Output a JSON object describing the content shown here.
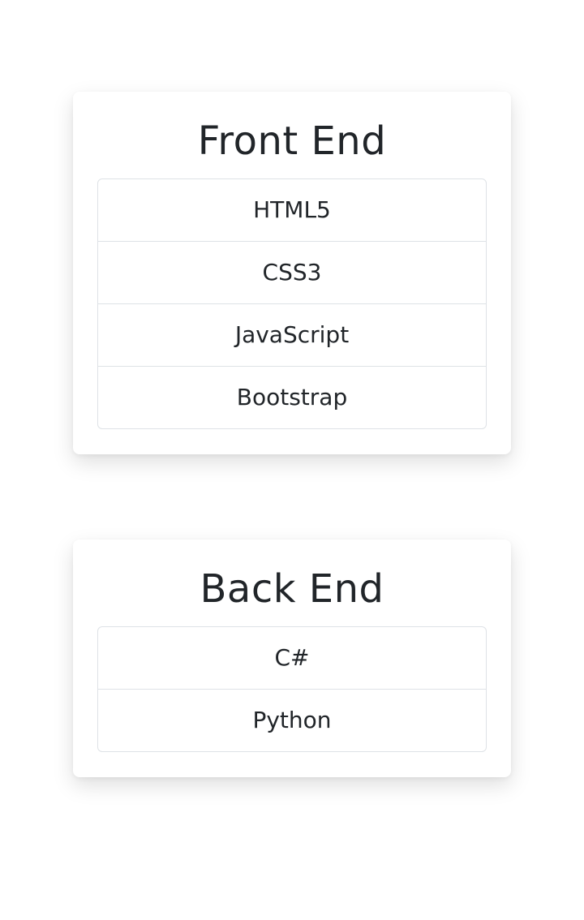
{
  "cards": [
    {
      "title": "Front End",
      "items": [
        "HTML5",
        "CSS3",
        "JavaScript",
        "Bootstrap"
      ]
    },
    {
      "title": "Back End",
      "items": [
        "C#",
        "Python"
      ]
    }
  ]
}
